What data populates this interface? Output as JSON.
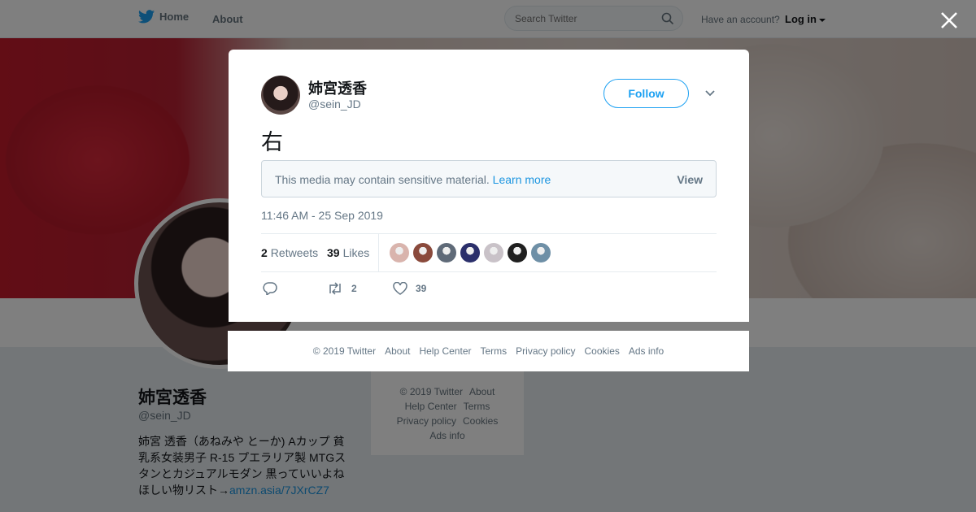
{
  "topbar": {
    "home_label": "Home",
    "about_label": "About",
    "search_placeholder": "Search Twitter",
    "have_account": "Have an account?",
    "login_label": "Log in"
  },
  "profile": {
    "name": "姉宮透香",
    "handle": "@sein_JD",
    "bio": "姉宮 透香（あねみや とーか) Aカップ 貧乳系女装男子 R-15 プエラリア製 MTGスタンとカジュアルモダン 黒っていいよね ほしい物リスト→",
    "bio_link": "amzn.asia/7JXrCZ7"
  },
  "side_footer": {
    "items": [
      "© 2019 Twitter",
      "About",
      "Help Center",
      "Terms",
      "Privacy policy",
      "Cookies",
      "Ads info"
    ]
  },
  "tweet": {
    "author_name": "姉宮透香",
    "author_handle": "@sein_JD",
    "follow_label": "Follow",
    "text": "右",
    "sensitive_notice": "This media may contain sensitive material.",
    "learn_more": "Learn more",
    "view_label": "View",
    "timestamp": "11:46 AM - 25 Sep 2019",
    "retweets_count": "2",
    "retweets_label": "Retweets",
    "likes_count": "39",
    "likes_label": "Likes",
    "reply_count": "",
    "retweet_action_count": "2",
    "like_action_count": "39",
    "liker_colors": [
      "#d9b4ad",
      "#8a4a3c",
      "#5f6a78",
      "#2b2f6b",
      "#c9c2c8",
      "#1f1f1f",
      "#6e8fa6"
    ]
  },
  "modal_footer": {
    "items": [
      "© 2019 Twitter",
      "About",
      "Help Center",
      "Terms",
      "Privacy policy",
      "Cookies",
      "Ads info"
    ]
  },
  "colors": {
    "brand": "#1da1f2",
    "link": "#1b95e0"
  }
}
